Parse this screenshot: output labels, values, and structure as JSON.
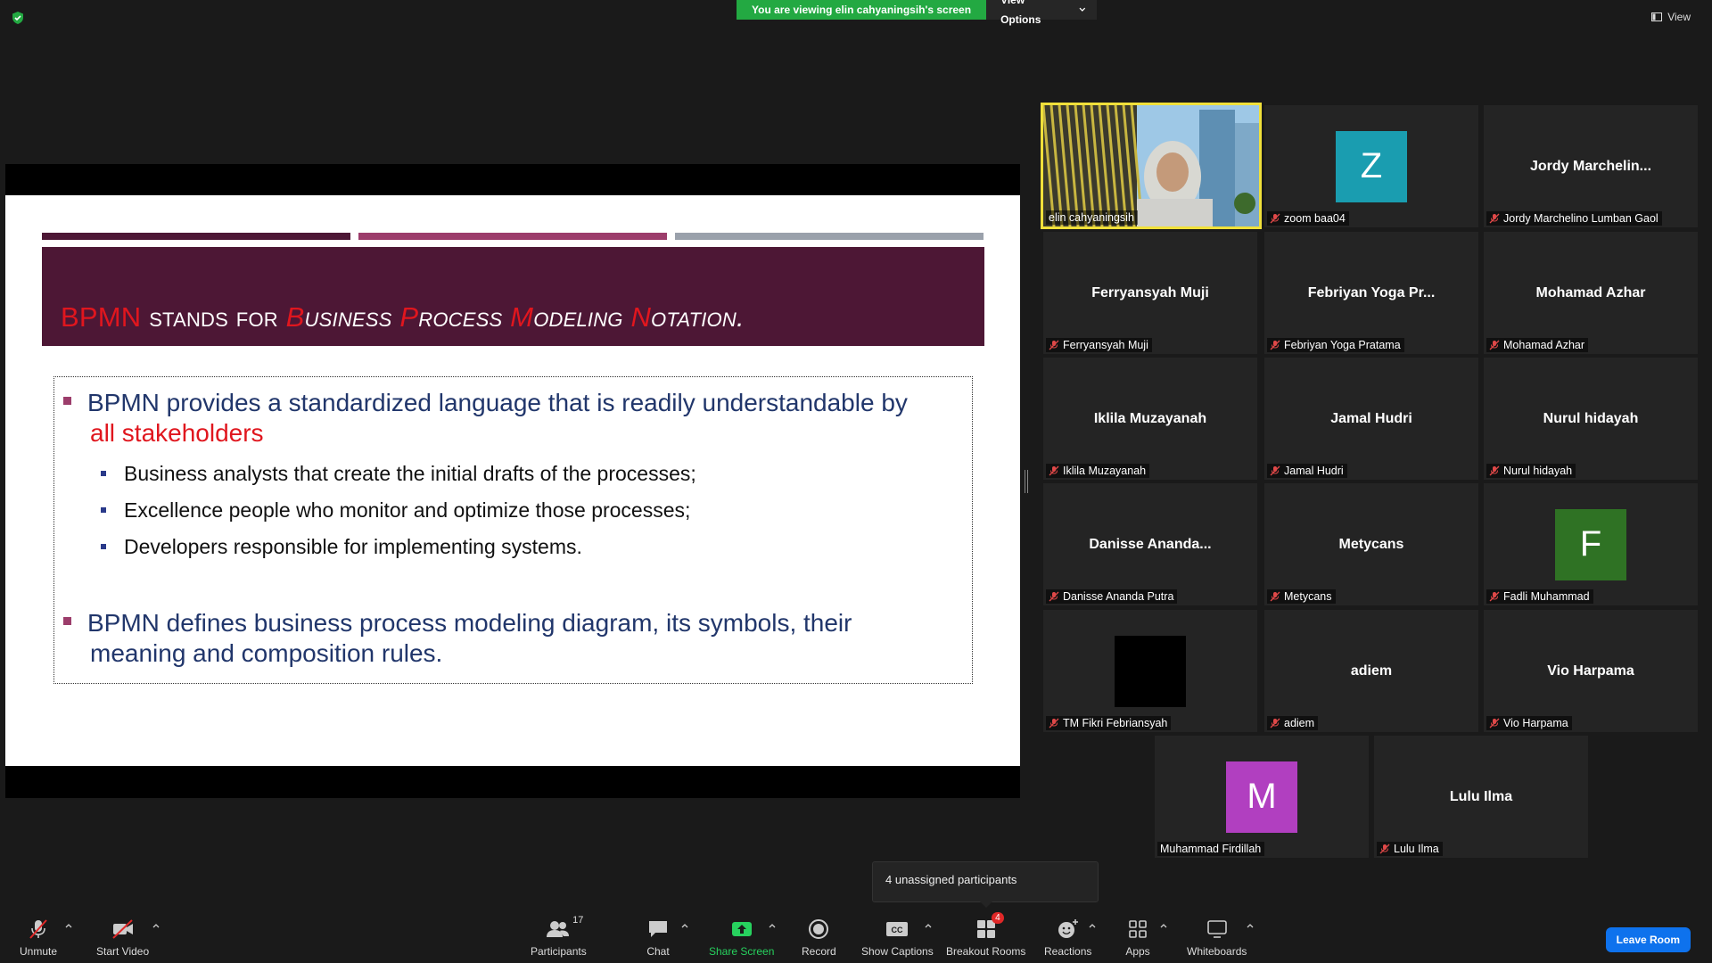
{
  "banner": {
    "viewing_text": "You are viewing elin cahyaningsih's screen",
    "view_options": "View Options"
  },
  "top_right": {
    "view_label": "View"
  },
  "slide": {
    "title_parts": [
      {
        "text": "BPMN",
        "style": "red"
      },
      {
        "text": " stands for ",
        "style": "white"
      },
      {
        "text": "B",
        "style": "red-italic"
      },
      {
        "text": "usiness ",
        "style": "white-italic"
      },
      {
        "text": "P",
        "style": "red-italic"
      },
      {
        "text": "rocess ",
        "style": "white-italic"
      },
      {
        "text": "M",
        "style": "red-italic"
      },
      {
        "text": "odeling ",
        "style": "white-italic"
      },
      {
        "text": "N",
        "style": "red-italic"
      },
      {
        "text": "otation.",
        "style": "white-italic"
      }
    ],
    "bullet1_line1": "BPMN provides a standardized language that is readily understandable by",
    "bullet1_line2": "all stakeholders",
    "sub_bullets": [
      "Business analysts that create the initial drafts of the processes;",
      "Excellence people who monitor and optimize those processes;",
      "Developers responsible for implementing systems."
    ],
    "bullet2_line1": "BPMN defines business process modeling diagram, its symbols, their",
    "bullet2_line2": "meaning and composition rules."
  },
  "participants": [
    {
      "big": "",
      "label": "elin cahyaningsih",
      "muted": false,
      "video": true,
      "active": true
    },
    {
      "big": "",
      "label": "zoom baa04",
      "muted": true,
      "avatar": "Z",
      "avatar_color": "#1a9db0"
    },
    {
      "big": "Jordy  Marchelin...",
      "label": "Jordy Marchelino Lumban Gaol",
      "muted": true
    },
    {
      "big": "Ferryansyah Muji",
      "label": "Ferryansyah Muji",
      "muted": true
    },
    {
      "big": "Febriyan  Yoga  Pr...",
      "label": "Febriyan Yoga Pratama",
      "muted": true
    },
    {
      "big": "Mohamad Azhar",
      "label": "Mohamad Azhar",
      "muted": true
    },
    {
      "big": "Iklila Muzayanah",
      "label": "Iklila Muzayanah",
      "muted": true
    },
    {
      "big": "Jamal Hudri",
      "label": "Jamal Hudri",
      "muted": true
    },
    {
      "big": "Nurul hidayah",
      "label": "Nurul hidayah",
      "muted": true
    },
    {
      "big": "Danisse  Ananda...",
      "label": "Danisse Ananda Putra",
      "muted": true
    },
    {
      "big": "Metycans",
      "label": "Metycans",
      "muted": true
    },
    {
      "big": "",
      "label": "Fadli Muhammad",
      "muted": true,
      "avatar": "F",
      "avatar_color": "#2f7224"
    },
    {
      "big": "",
      "label": "TM Fikri Febriansyah",
      "muted": true,
      "avatar": " ",
      "avatar_color": "#000000"
    },
    {
      "big": "adiem",
      "label": "adiem",
      "muted": true
    },
    {
      "big": "Vio Harpama",
      "label": "Vio Harpama",
      "muted": true
    },
    {
      "big": "",
      "label": "Muhammad Firdillah",
      "muted": false,
      "avatar": "M",
      "avatar_color": "#b13fc0"
    },
    {
      "big": "Lulu Ilma",
      "label": "Lulu Ilma",
      "muted": true
    }
  ],
  "tooltip": "4 unassigned participants",
  "toolbar": {
    "unmute": "Unmute",
    "start_video": "Start Video",
    "participants": "Participants",
    "participants_count": "17",
    "chat": "Chat",
    "share_screen": "Share Screen",
    "record": "Record",
    "show_captions": "Show Captions",
    "breakout_rooms": "Breakout Rooms",
    "breakout_badge": "4",
    "reactions": "Reactions",
    "apps": "Apps",
    "whiteboards": "Whiteboards",
    "leave_room": "Leave Room"
  },
  "colors": {
    "banner_green": "#23a942",
    "share_green": "#27d15e",
    "leave_blue": "#0e72ed",
    "slide_maroon": "#4d1735",
    "slide_red": "#e0161e",
    "slide_navy": "#21366b"
  }
}
